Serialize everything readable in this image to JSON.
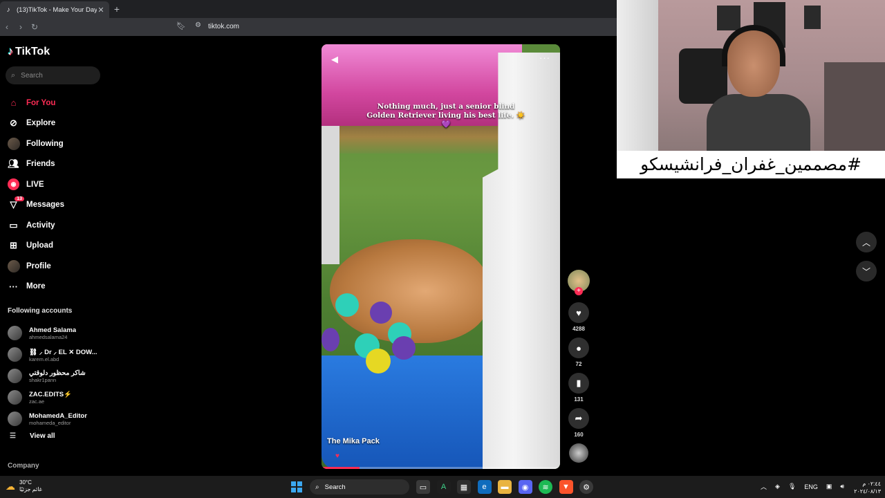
{
  "browser": {
    "tab_title": "(13)TikTok - Make Your Day",
    "tab_close": "✕",
    "new_tab": "+",
    "url": "tiktok.com"
  },
  "sidebar": {
    "logo_text": "TikTok",
    "search_placeholder": "Search",
    "nav": [
      {
        "label": "For You",
        "icon": "home-icon",
        "active": true
      },
      {
        "label": "Explore",
        "icon": "compass-icon"
      },
      {
        "label": "Following",
        "icon": "following-avatar-icon"
      },
      {
        "label": "Friends",
        "icon": "friends-icon"
      },
      {
        "label": "LIVE",
        "icon": "live-icon"
      },
      {
        "label": "Messages",
        "icon": "messages-icon",
        "badge": "13"
      },
      {
        "label": "Activity",
        "icon": "activity-icon"
      },
      {
        "label": "Upload",
        "icon": "upload-icon"
      },
      {
        "label": "Profile",
        "icon": "profile-avatar-icon"
      },
      {
        "label": "More",
        "icon": "more-icon"
      }
    ],
    "following_title": "Following accounts",
    "accounts": [
      {
        "name": "Ahmed Salama",
        "handle": "ahmedsalama24"
      },
      {
        "name": "⛓ ⸝ Dr ⸝ EL ✕ DOW...",
        "handle": "karem.el.abd"
      },
      {
        "name": "شاكر محظور دلوقتي",
        "handle": "shakr1pann"
      },
      {
        "name": "ZAC.EDITS⚡",
        "handle": "zac.ae"
      },
      {
        "name": "MohamedA_Editor",
        "handle": "mohameda_editor"
      }
    ],
    "view_all": "View all",
    "company": "Company"
  },
  "video": {
    "caption": "Nothing much, just a senior blind Golden Retriever living his best life. ☀️💜",
    "author": "The Mika Pack",
    "progress": 0.16,
    "more": "···"
  },
  "actions": {
    "likes": "4288",
    "comments": "72",
    "saves": "131",
    "shares": "160"
  },
  "overlay": {
    "hashtag": "#مصممين_غفران_فرانشيسكو"
  },
  "taskbar": {
    "temp": "30°C",
    "weather_desc": "غائم جزئيًا",
    "search": "Search",
    "lang": "ENG",
    "time": "٠٢:٤٤ م",
    "date": "٢٠٢٤/٠٨/١٣"
  },
  "colors": {
    "accent": "#fe2c55",
    "cyan": "#25f4ee"
  }
}
